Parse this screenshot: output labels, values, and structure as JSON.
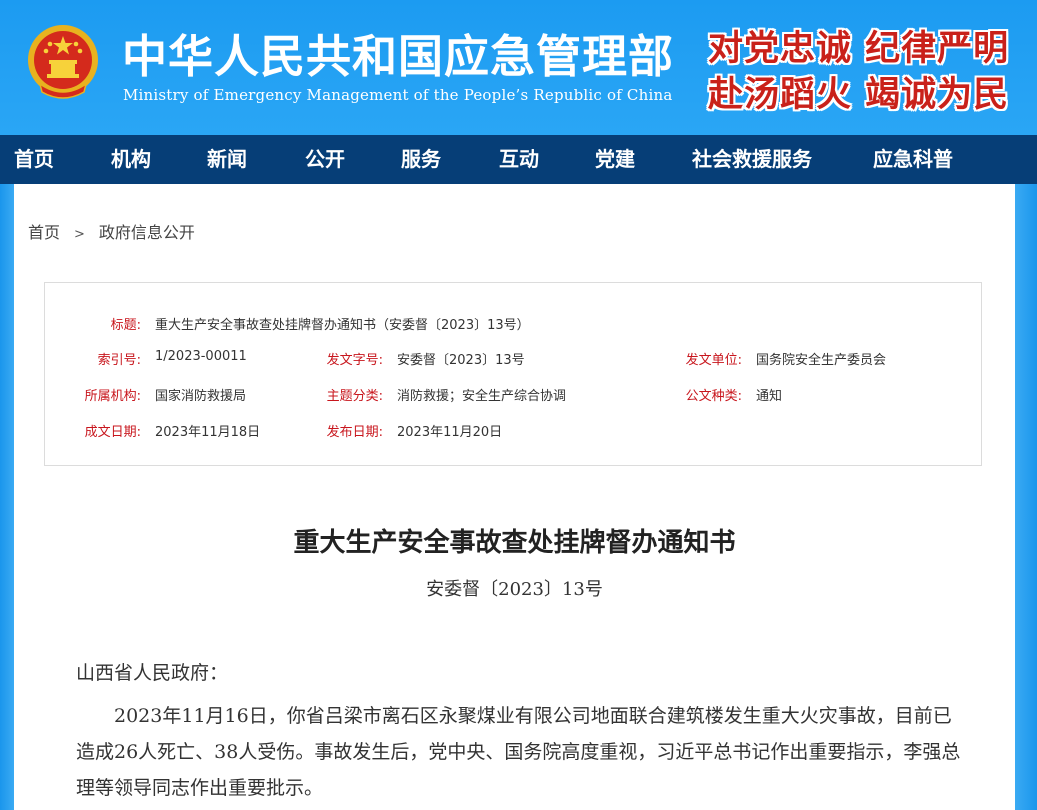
{
  "header": {
    "title": "中华人民共和国应急管理部",
    "subtitle": "Ministry of Emergency Management of the People’s Republic of China",
    "slogan_line1": "对党忠诚  纪律严明",
    "slogan_line2": "赴汤蹈火  竭诚为民",
    "emblem_icon": "national-emblem-icon"
  },
  "nav": {
    "items": [
      {
        "label": "首页"
      },
      {
        "label": "机构"
      },
      {
        "label": "新闻"
      },
      {
        "label": "公开"
      },
      {
        "label": "服务"
      },
      {
        "label": "互动"
      },
      {
        "label": "党建"
      },
      {
        "label": "社会救援服务"
      },
      {
        "label": "应急科普"
      }
    ]
  },
  "breadcrumb": {
    "home": "首页",
    "separator": ">",
    "current": "政府信息公开"
  },
  "meta": {
    "title_label": "标题:",
    "title_value": "重大生产安全事故查处挂牌督办通知书（安委督〔2023〕13号）",
    "index_label": "索引号:",
    "index_value": "1/2023-00011",
    "docno_label": "发文字号:",
    "docno_value": "安委督〔2023〕13号",
    "issuer_label": "发文单位:",
    "issuer_value": "国务院安全生产委员会",
    "org_label": "所属机构:",
    "org_value": "国家消防救援局",
    "topic_label": "主题分类:",
    "topic_value": "消防救援；安全生产综合协调",
    "type_label": "公文种类:",
    "type_value": "通知",
    "date_label": "成文日期:",
    "date_value": "2023年11月18日",
    "pubdate_label": "发布日期:",
    "pubdate_value": "2023年11月20日"
  },
  "document": {
    "title": "重大生产安全事故查处挂牌督办通知书",
    "number": "安委督〔2023〕13号",
    "salutation": "山西省人民政府：",
    "paragraph1": "2023年11月16日，你省吕梁市离石区永聚煤业有限公司地面联合建筑楼发生重大火灾事故，目前已造成26人死亡、38人受伤。事故发生后，党中央、国务院高度重视，习近平总书记作出重要指示，李强总理等领导同志作出重要批示。"
  },
  "colors": {
    "header_blue": "#1e9cf0",
    "nav_navy": "#063e77",
    "label_red": "#c8161d",
    "slogan_red": "#c9211a"
  }
}
